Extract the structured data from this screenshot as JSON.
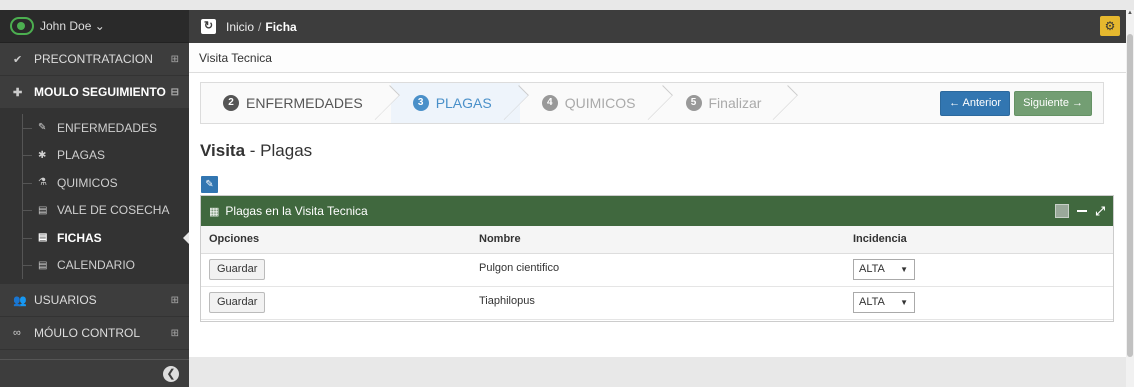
{
  "user": {
    "name": "John Doe ⌄"
  },
  "sidebar": {
    "items": [
      {
        "icon": "✔",
        "label": "PRECONTRATACION",
        "expand": "⊞"
      },
      {
        "icon": "✚",
        "label": "MOULO SEGUIMIENTO",
        "expand": "⊟"
      }
    ],
    "subitems": [
      {
        "icon": "✎",
        "label": "ENFERMEDADES"
      },
      {
        "icon": "✱",
        "label": "PLAGAS"
      },
      {
        "icon": "⚗",
        "label": "QUIMICOS"
      },
      {
        "icon": "▤",
        "label": "VALE DE COSECHA"
      },
      {
        "icon": "▤",
        "label": "FICHAS"
      },
      {
        "icon": "▤",
        "label": "CALENDARIO"
      }
    ],
    "bottom_items": [
      {
        "icon": "👥",
        "label": "USUARIOS",
        "expand": "⊞"
      },
      {
        "icon": "∞",
        "label": "MÓULO CONTROL",
        "expand": "⊞"
      }
    ],
    "collapse_icon": "❮"
  },
  "topbar": {
    "refresh_icon": "↻",
    "crumb_home": "Inicio",
    "crumb_sep": "/",
    "crumb_current": "Ficha",
    "settings_icon": "⚙"
  },
  "main": {
    "title": "Visita Tecnica",
    "wizard": {
      "steps": [
        {
          "num": "2",
          "label": "ENFERMEDADES"
        },
        {
          "num": "3",
          "label": "PLAGAS"
        },
        {
          "num": "4",
          "label": "QUIMICOS"
        },
        {
          "num": "5",
          "label": "Finalizar"
        }
      ],
      "prev_label": "← Anterior",
      "next_label": "Siguiente →"
    },
    "heading_bold": "Visita",
    "heading_rest": " - Plagas",
    "edit_icon": "✎",
    "widget": {
      "icon": "▦",
      "title": "Plagas en la Visita Tecnica",
      "columns": [
        "Opciones",
        "Nombre",
        "Incidencia"
      ],
      "rows": [
        {
          "action": "Guardar",
          "name": "Pulgon cientifico",
          "incidence": "ALTA"
        },
        {
          "action": "Guardar",
          "name": "Tiaphilopus",
          "incidence": "ALTA"
        }
      ]
    }
  }
}
